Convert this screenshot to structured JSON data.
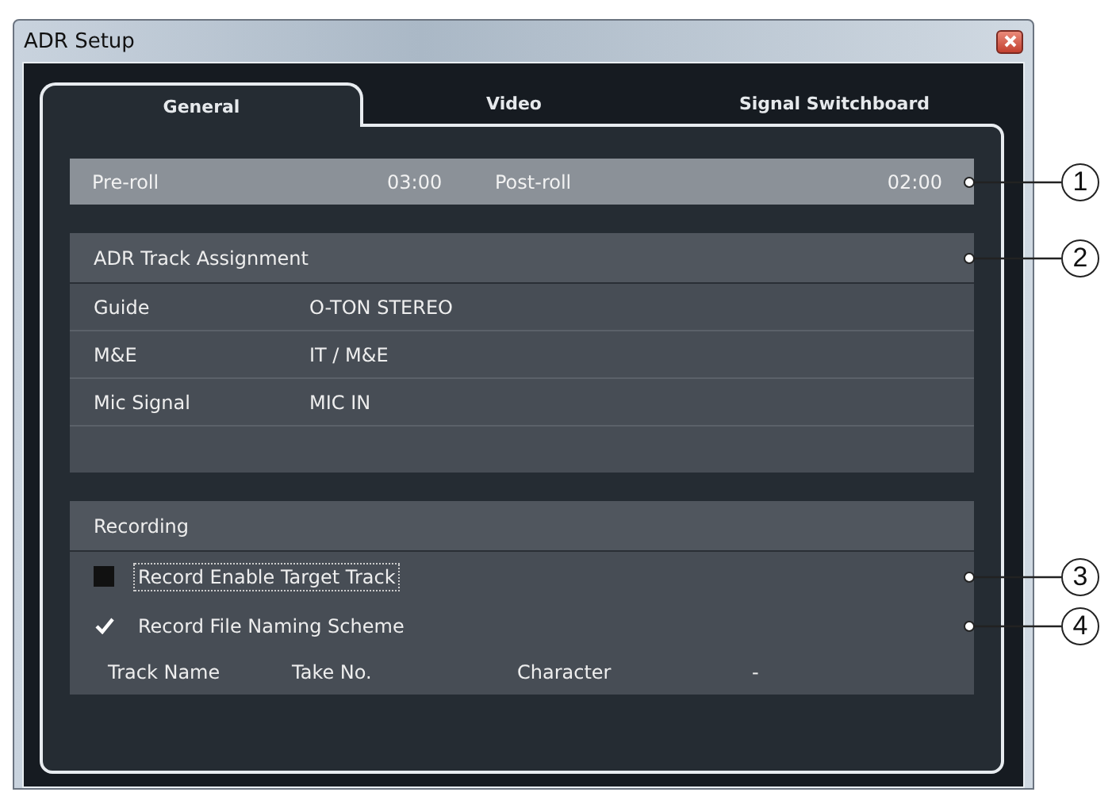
{
  "window": {
    "title": "ADR Setup"
  },
  "tabs": [
    {
      "label": "General",
      "selected": true
    },
    {
      "label": "Video",
      "selected": false
    },
    {
      "label": "Signal Switchboard",
      "selected": false
    }
  ],
  "preroll": {
    "pre_label": "Pre-roll",
    "pre_value": "03:00",
    "post_label": "Post-roll",
    "post_value": "02:00",
    "callout": "1"
  },
  "track_assignment": {
    "title": "ADR Track Assignment",
    "callout": "2",
    "rows": [
      {
        "label": "Guide",
        "value": "O-TON STEREO"
      },
      {
        "label": "M&E",
        "value": "IT / M&E"
      },
      {
        "label": "Mic Signal",
        "value": "MIC IN"
      }
    ]
  },
  "recording": {
    "title": "Recording",
    "options": [
      {
        "label": "Record Enable Target Track",
        "checked": false,
        "focused": true,
        "callout": "3"
      },
      {
        "label": "Record File Naming Scheme",
        "checked": true,
        "focused": false,
        "callout": "4"
      }
    ],
    "naming_scheme": [
      "Track Name",
      "Take No.",
      "Character",
      "-"
    ]
  }
}
